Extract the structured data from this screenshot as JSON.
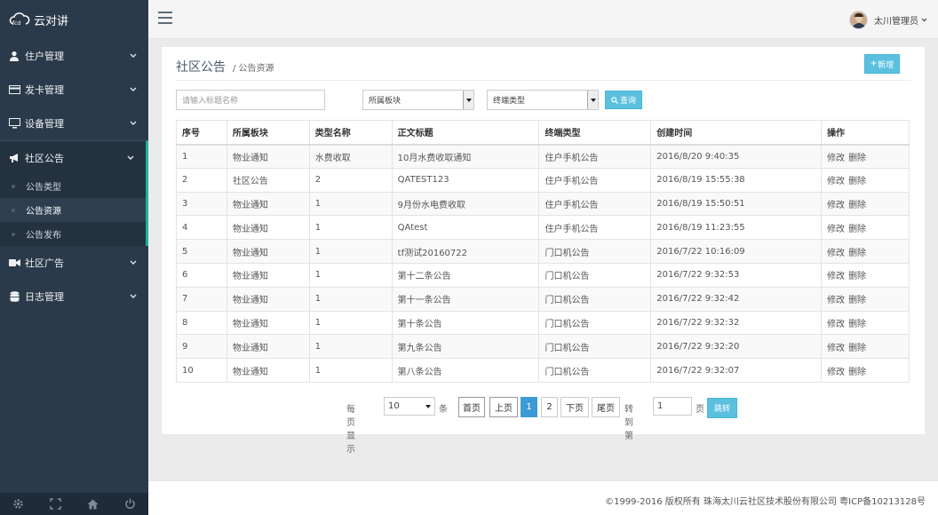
{
  "app": {
    "logo_text": "云对讲",
    "logo_mark": "fcd"
  },
  "sidebar": {
    "items": [
      {
        "label": "住户管理"
      },
      {
        "label": "发卡管理"
      },
      {
        "label": "设备管理"
      },
      {
        "label": "社区公告"
      },
      {
        "label": "社区广告"
      },
      {
        "label": "日志管理"
      }
    ],
    "submenu": [
      {
        "label": "公告类型"
      },
      {
        "label": "公告资源"
      },
      {
        "label": "公告发布"
      }
    ]
  },
  "header": {
    "user_name": "太川管理员"
  },
  "page": {
    "title": "社区公告",
    "breadcrumb": "/ 公告资源",
    "new_button": "新增"
  },
  "filters": {
    "title_placeholder": "请输入标题名称",
    "board_value": "所属板块",
    "terminal_value": "终端类型",
    "search_button": "查询"
  },
  "table": {
    "columns": [
      "序号",
      "所属板块",
      "类型名称",
      "正文标题",
      "终端类型",
      "创建时间",
      "操作"
    ],
    "rows": [
      [
        "1",
        "物业通知",
        "水费收取",
        "10月水费收取通知",
        "住户手机公告",
        "2016/8/20 9:40:35"
      ],
      [
        "2",
        "社区公告",
        "2",
        "QATEST123",
        "住户手机公告",
        "2016/8/19 15:55:38"
      ],
      [
        "3",
        "物业通知",
        "1",
        "9月份水电费收取",
        "住户手机公告",
        "2016/8/19 15:50:51"
      ],
      [
        "4",
        "物业通知",
        "1",
        "QAtest",
        "住户手机公告",
        "2016/8/19 11:23:55"
      ],
      [
        "5",
        "物业通知",
        "1",
        "tf测试20160722",
        "门口机公告",
        "2016/7/22 10:16:09"
      ],
      [
        "6",
        "物业通知",
        "1",
        "第十二条公告",
        "门口机公告",
        "2016/7/22 9:32:53"
      ],
      [
        "7",
        "物业通知",
        "1",
        "第十一条公告",
        "门口机公告",
        "2016/7/22 9:32:42"
      ],
      [
        "8",
        "物业通知",
        "1",
        "第十条公告",
        "门口机公告",
        "2016/7/22 9:32:32"
      ],
      [
        "9",
        "物业通知",
        "1",
        "第九条公告",
        "门口机公告",
        "2016/7/22 9:32:20"
      ],
      [
        "10",
        "物业通知",
        "1",
        "第八条公告",
        "门口机公告",
        "2016/7/22 9:32:07"
      ]
    ],
    "edit_label": "修改",
    "delete_label": "删除"
  },
  "pagination": {
    "per_page_label": "每页显示",
    "per_page_value": "10",
    "per_page_unit": "条",
    "first": "首页",
    "prev": "上页",
    "pages": [
      "1",
      "2"
    ],
    "current_page": "1",
    "next": "下页",
    "last": "尾页",
    "goto_label": "转到第",
    "goto_value": "1",
    "goto_unit": "页",
    "jump_button": "跳转"
  },
  "footer": {
    "copyright": "©1999-2016 版权所有 珠海太川云社区技术股份有限公司 粤ICP备10213128号"
  },
  "colors": {
    "sidebar_bg": "#2b3a4a",
    "accent": "#1ab394",
    "button": "#5bc0de",
    "active_page": "#3c9bd6"
  }
}
